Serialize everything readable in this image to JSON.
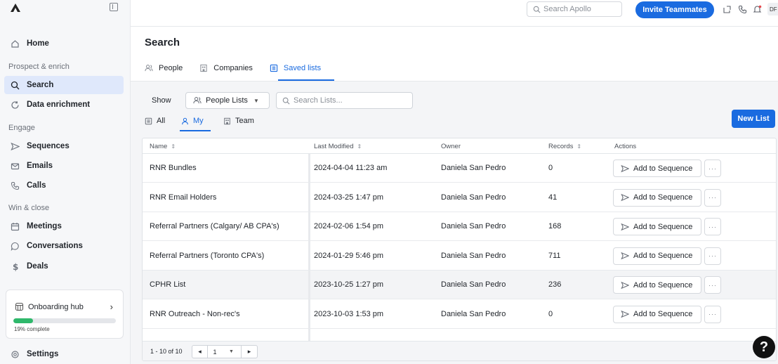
{
  "sidebar": {
    "home": "Home",
    "section_prospect": "Prospect & enrich",
    "search": "Search",
    "data_enrichment": "Data enrichment",
    "section_engage": "Engage",
    "sequences": "Sequences",
    "emails": "Emails",
    "calls": "Calls",
    "section_win": "Win & close",
    "meetings": "Meetings",
    "conversations": "Conversations",
    "deals": "Deals",
    "onboarding_title": "Onboarding hub",
    "onboarding_progress": 0.19,
    "onboarding_pct_label": "19% complete",
    "settings": "Settings"
  },
  "topbar": {
    "search_placeholder": "Search Apollo",
    "invite_label": "Invite Teammates",
    "avatar_initials": "DF"
  },
  "page": {
    "title": "Search",
    "tabs": [
      "People",
      "Companies",
      "Saved lists"
    ]
  },
  "filters": {
    "show_label": "Show",
    "list_type": "People Lists",
    "search_placeholder": "Search Lists...",
    "scopes": [
      "All",
      "My",
      "Team"
    ],
    "new_list_label": "New List"
  },
  "table": {
    "headers": [
      "Name",
      "Last Modified",
      "Owner",
      "Records",
      "Actions"
    ],
    "rows": [
      {
        "name": "RNR Bundles",
        "modified": "2024-04-04 11:23 am",
        "owner": "Daniela San Pedro",
        "records": "0"
      },
      {
        "name": "RNR Email Holders",
        "modified": "2024-03-25 1:47 pm",
        "owner": "Daniela San Pedro",
        "records": "41"
      },
      {
        "name": "Referral Partners (Calgary/ AB CPA's)",
        "modified": "2024-02-06 1:54 pm",
        "owner": "Daniela San Pedro",
        "records": "168"
      },
      {
        "name": "Referral Partners (Toronto CPA's)",
        "modified": "2024-01-29 5:46 pm",
        "owner": "Daniela San Pedro",
        "records": "711"
      },
      {
        "name": "CPHR List",
        "modified": "2023-10-25 1:27 pm",
        "owner": "Daniela San Pedro",
        "records": "236"
      },
      {
        "name": "RNR Outreach - Non-rec's",
        "modified": "2023-10-03 1:53 pm",
        "owner": "Daniela San Pedro",
        "records": "0"
      }
    ],
    "action_label": "Add to Sequence",
    "more_label": "···",
    "count_label": "1 - 10 of 10",
    "page_number": "1"
  },
  "help_label": "?"
}
